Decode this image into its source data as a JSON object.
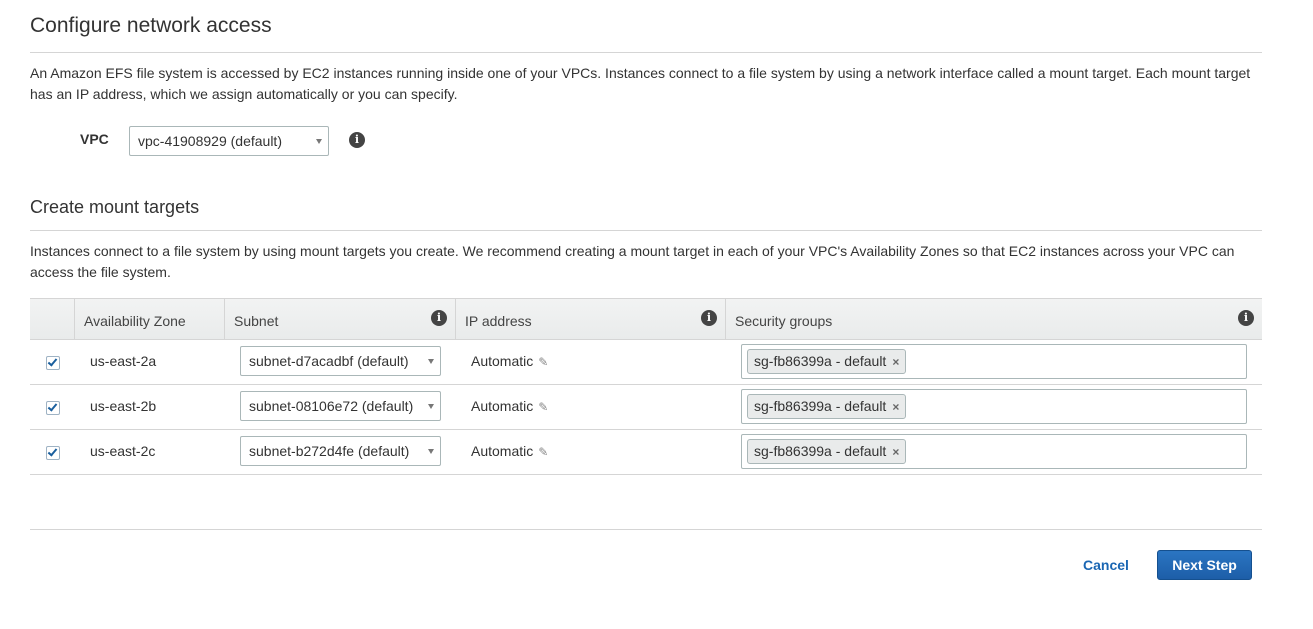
{
  "network": {
    "title": "Configure network access",
    "description": "An Amazon EFS file system is accessed by EC2 instances running inside one of your VPCs. Instances connect to a file system by using a network interface called a mount target. Each mount target has an IP address, which we assign automatically or you can specify.",
    "vpc_label": "VPC",
    "vpc_value": "vpc-41908929 (default)"
  },
  "mount": {
    "title": "Create mount targets",
    "description": "Instances connect to a file system by using mount targets you create. We recommend creating a mount target in each of your VPC's Availability Zones so that EC2 instances across your VPC can access the file system."
  },
  "table": {
    "columns": [
      "Availability Zone",
      "Subnet",
      "IP address",
      "Security groups"
    ],
    "rows": [
      {
        "checked": true,
        "zone": "us-east-2a",
        "subnet": "subnet-d7acadbf (default)",
        "ip": "Automatic",
        "security_group": "sg-fb86399a - default"
      },
      {
        "checked": true,
        "zone": "us-east-2b",
        "subnet": "subnet-08106e72 (default)",
        "ip": "Automatic",
        "security_group": "sg-fb86399a - default"
      },
      {
        "checked": true,
        "zone": "us-east-2c",
        "subnet": "subnet-b272d4fe (default)",
        "ip": "Automatic",
        "security_group": "sg-fb86399a - default"
      }
    ]
  },
  "footer": {
    "cancel_label": "Cancel",
    "next_label": "Next Step"
  },
  "icons": {
    "info": "info-icon",
    "edit": "pencil-icon",
    "remove": "close-icon",
    "dropdown": "chevron-down-icon",
    "checkbox": "checkbox-checked"
  },
  "colors": {
    "primary_button": "#1d5ea8",
    "link": "#1a66b3",
    "border": "#d5d5d5"
  }
}
